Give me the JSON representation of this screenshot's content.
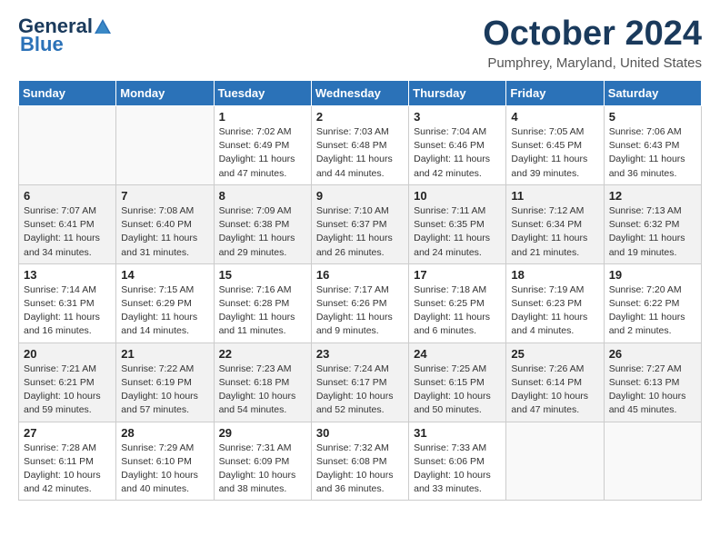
{
  "header": {
    "logo_line1": "General",
    "logo_line2": "Blue",
    "month": "October 2024",
    "location": "Pumphrey, Maryland, United States"
  },
  "weekdays": [
    "Sunday",
    "Monday",
    "Tuesday",
    "Wednesday",
    "Thursday",
    "Friday",
    "Saturday"
  ],
  "weeks": [
    [
      {
        "day": "",
        "info": ""
      },
      {
        "day": "",
        "info": ""
      },
      {
        "day": "1",
        "info": "Sunrise: 7:02 AM\nSunset: 6:49 PM\nDaylight: 11 hours and 47 minutes."
      },
      {
        "day": "2",
        "info": "Sunrise: 7:03 AM\nSunset: 6:48 PM\nDaylight: 11 hours and 44 minutes."
      },
      {
        "day": "3",
        "info": "Sunrise: 7:04 AM\nSunset: 6:46 PM\nDaylight: 11 hours and 42 minutes."
      },
      {
        "day": "4",
        "info": "Sunrise: 7:05 AM\nSunset: 6:45 PM\nDaylight: 11 hours and 39 minutes."
      },
      {
        "day": "5",
        "info": "Sunrise: 7:06 AM\nSunset: 6:43 PM\nDaylight: 11 hours and 36 minutes."
      }
    ],
    [
      {
        "day": "6",
        "info": "Sunrise: 7:07 AM\nSunset: 6:41 PM\nDaylight: 11 hours and 34 minutes."
      },
      {
        "day": "7",
        "info": "Sunrise: 7:08 AM\nSunset: 6:40 PM\nDaylight: 11 hours and 31 minutes."
      },
      {
        "day": "8",
        "info": "Sunrise: 7:09 AM\nSunset: 6:38 PM\nDaylight: 11 hours and 29 minutes."
      },
      {
        "day": "9",
        "info": "Sunrise: 7:10 AM\nSunset: 6:37 PM\nDaylight: 11 hours and 26 minutes."
      },
      {
        "day": "10",
        "info": "Sunrise: 7:11 AM\nSunset: 6:35 PM\nDaylight: 11 hours and 24 minutes."
      },
      {
        "day": "11",
        "info": "Sunrise: 7:12 AM\nSunset: 6:34 PM\nDaylight: 11 hours and 21 minutes."
      },
      {
        "day": "12",
        "info": "Sunrise: 7:13 AM\nSunset: 6:32 PM\nDaylight: 11 hours and 19 minutes."
      }
    ],
    [
      {
        "day": "13",
        "info": "Sunrise: 7:14 AM\nSunset: 6:31 PM\nDaylight: 11 hours and 16 minutes."
      },
      {
        "day": "14",
        "info": "Sunrise: 7:15 AM\nSunset: 6:29 PM\nDaylight: 11 hours and 14 minutes."
      },
      {
        "day": "15",
        "info": "Sunrise: 7:16 AM\nSunset: 6:28 PM\nDaylight: 11 hours and 11 minutes."
      },
      {
        "day": "16",
        "info": "Sunrise: 7:17 AM\nSunset: 6:26 PM\nDaylight: 11 hours and 9 minutes."
      },
      {
        "day": "17",
        "info": "Sunrise: 7:18 AM\nSunset: 6:25 PM\nDaylight: 11 hours and 6 minutes."
      },
      {
        "day": "18",
        "info": "Sunrise: 7:19 AM\nSunset: 6:23 PM\nDaylight: 11 hours and 4 minutes."
      },
      {
        "day": "19",
        "info": "Sunrise: 7:20 AM\nSunset: 6:22 PM\nDaylight: 11 hours and 2 minutes."
      }
    ],
    [
      {
        "day": "20",
        "info": "Sunrise: 7:21 AM\nSunset: 6:21 PM\nDaylight: 10 hours and 59 minutes."
      },
      {
        "day": "21",
        "info": "Sunrise: 7:22 AM\nSunset: 6:19 PM\nDaylight: 10 hours and 57 minutes."
      },
      {
        "day": "22",
        "info": "Sunrise: 7:23 AM\nSunset: 6:18 PM\nDaylight: 10 hours and 54 minutes."
      },
      {
        "day": "23",
        "info": "Sunrise: 7:24 AM\nSunset: 6:17 PM\nDaylight: 10 hours and 52 minutes."
      },
      {
        "day": "24",
        "info": "Sunrise: 7:25 AM\nSunset: 6:15 PM\nDaylight: 10 hours and 50 minutes."
      },
      {
        "day": "25",
        "info": "Sunrise: 7:26 AM\nSunset: 6:14 PM\nDaylight: 10 hours and 47 minutes."
      },
      {
        "day": "26",
        "info": "Sunrise: 7:27 AM\nSunset: 6:13 PM\nDaylight: 10 hours and 45 minutes."
      }
    ],
    [
      {
        "day": "27",
        "info": "Sunrise: 7:28 AM\nSunset: 6:11 PM\nDaylight: 10 hours and 42 minutes."
      },
      {
        "day": "28",
        "info": "Sunrise: 7:29 AM\nSunset: 6:10 PM\nDaylight: 10 hours and 40 minutes."
      },
      {
        "day": "29",
        "info": "Sunrise: 7:31 AM\nSunset: 6:09 PM\nDaylight: 10 hours and 38 minutes."
      },
      {
        "day": "30",
        "info": "Sunrise: 7:32 AM\nSunset: 6:08 PM\nDaylight: 10 hours and 36 minutes."
      },
      {
        "day": "31",
        "info": "Sunrise: 7:33 AM\nSunset: 6:06 PM\nDaylight: 10 hours and 33 minutes."
      },
      {
        "day": "",
        "info": ""
      },
      {
        "day": "",
        "info": ""
      }
    ]
  ]
}
